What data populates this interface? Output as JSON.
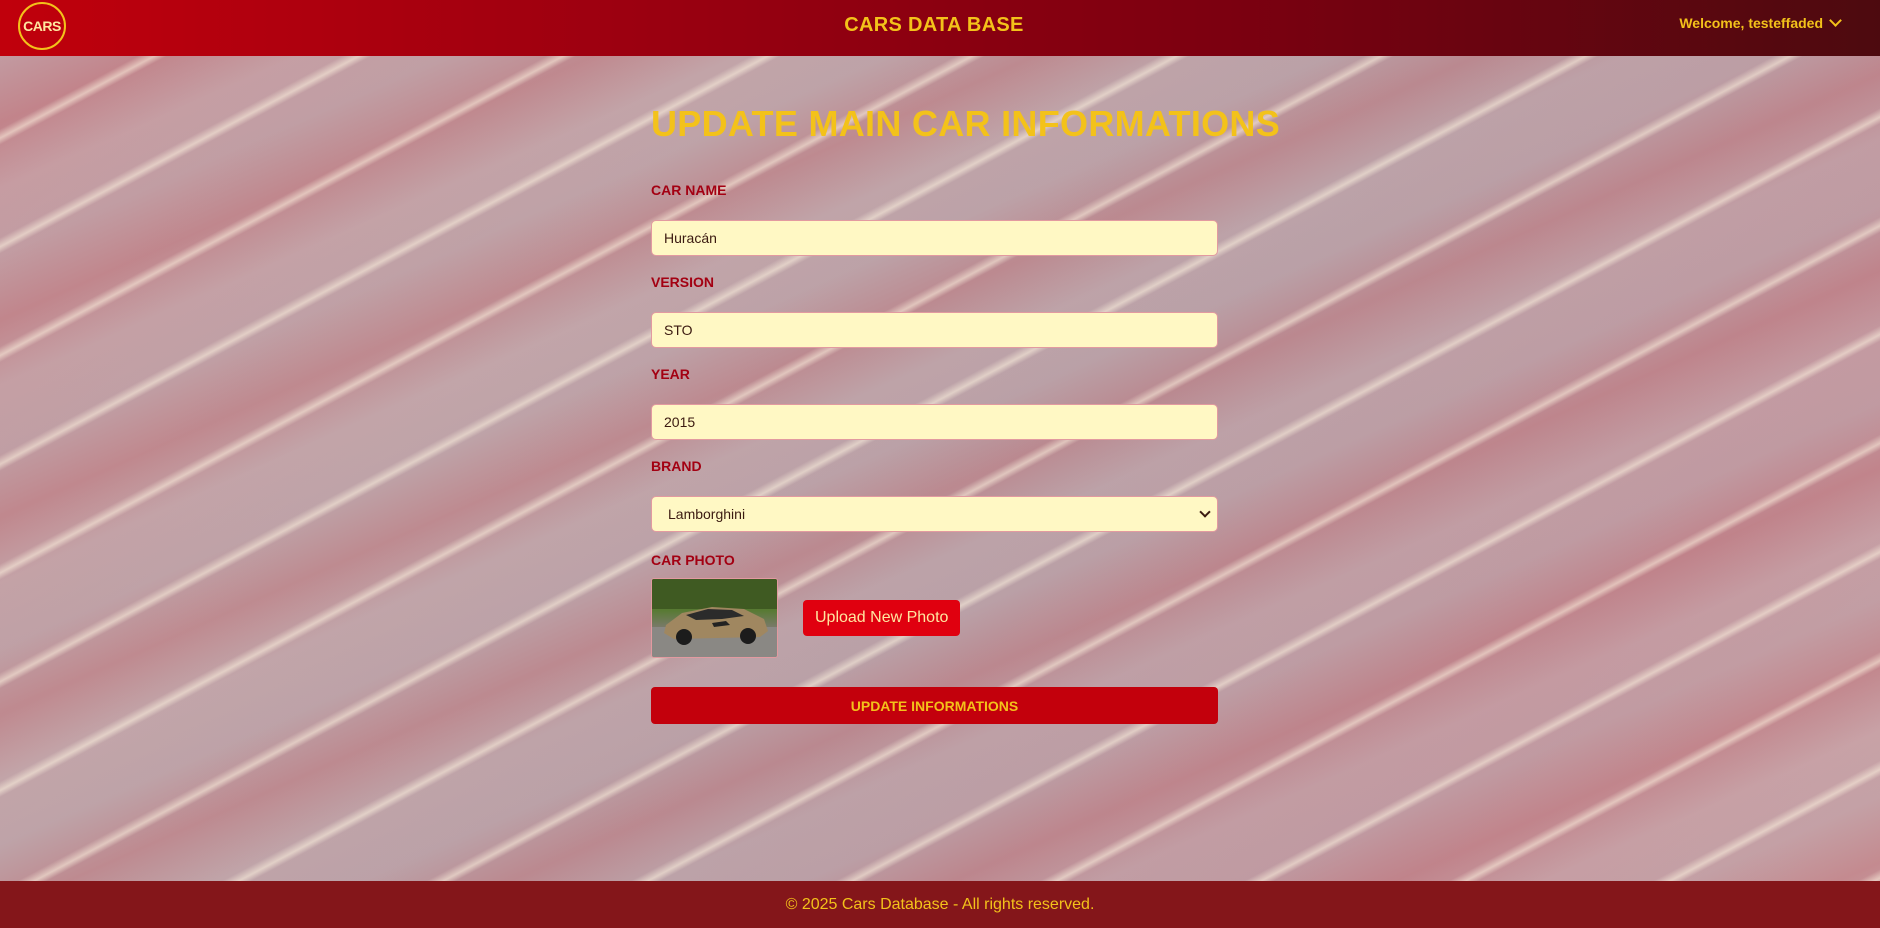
{
  "header": {
    "logo_text": "CARS",
    "app_title": "CARS DATA BASE",
    "user_menu_label": "Welcome, testeffaded"
  },
  "form": {
    "title": "UPDATE MAIN CAR INFORMATIONS",
    "car_name": {
      "label": "CAR NAME",
      "value": "Huracán"
    },
    "version": {
      "label": "VERSION",
      "value": "STO"
    },
    "year": {
      "label": "YEAR",
      "value": "2015"
    },
    "brand": {
      "label": "BRAND",
      "selected": "Lamborghini"
    },
    "photo": {
      "label": "CAR PHOTO",
      "upload_button": "Upload New Photo"
    },
    "submit_button": "UPDATE INFORMATIONS"
  },
  "footer": {
    "text": "© 2025 Cars Database - All rights reserved."
  },
  "colors": {
    "header_red": "#c0000c",
    "accent_gold": "#f3c21a",
    "label_red": "#a30012",
    "input_bg": "#fff8c4",
    "footer_bg": "#84161a"
  },
  "icons": {
    "user_menu": "chevron-down-icon",
    "brand_select": "chevron-down-icon"
  }
}
